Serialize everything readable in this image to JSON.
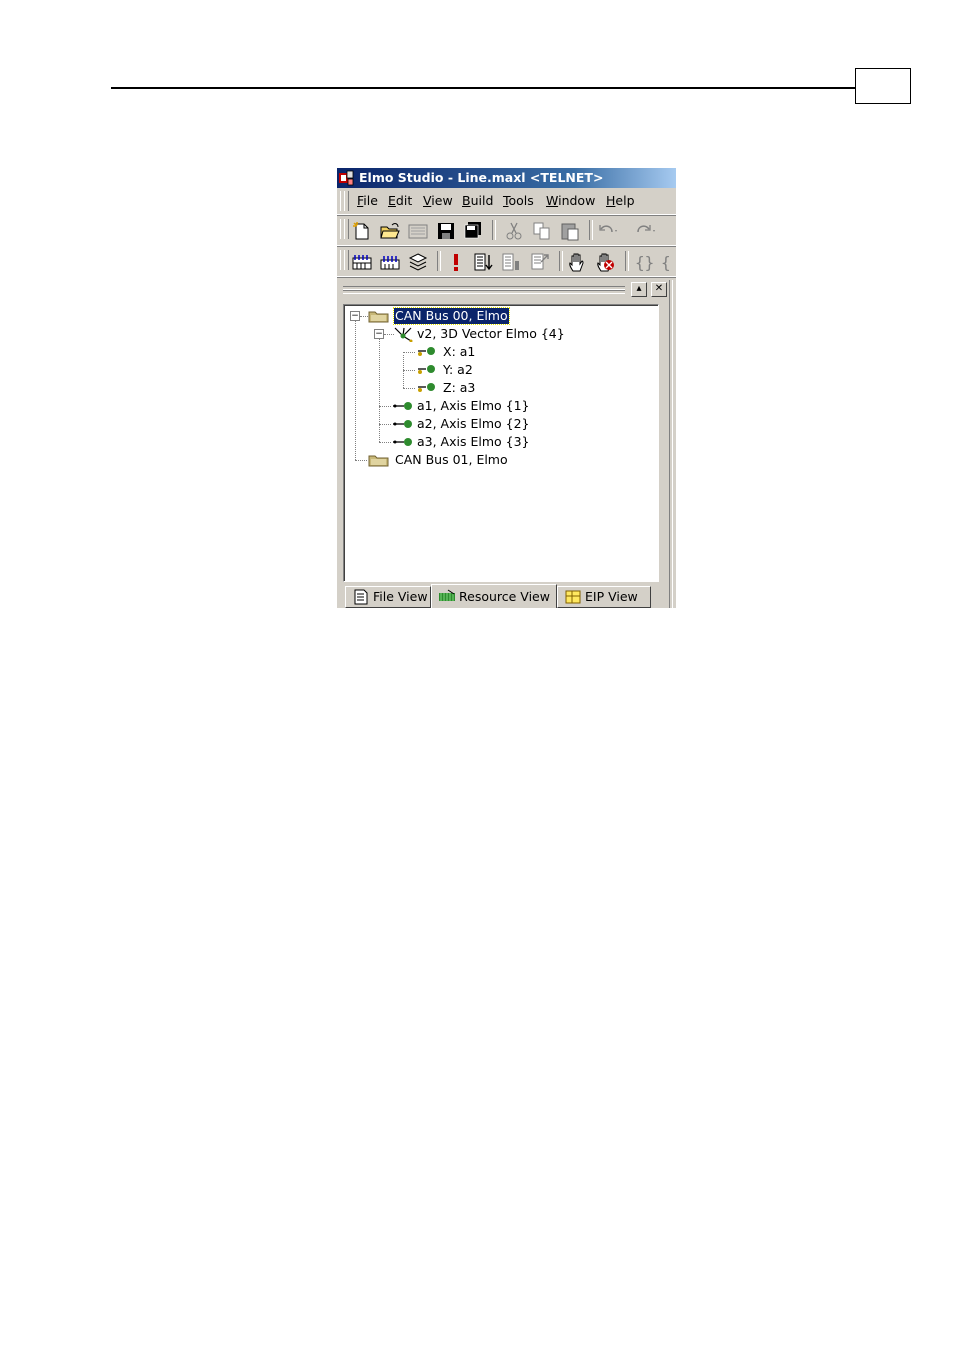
{
  "window": {
    "title": "Elmo Studio - Line.maxl <TELNET>"
  },
  "menu": [
    {
      "key": "F",
      "rest": "ile"
    },
    {
      "key": "E",
      "rest": "dit"
    },
    {
      "key": "V",
      "rest": "iew"
    },
    {
      "key": "B",
      "rest": "uild"
    },
    {
      "key": "T",
      "rest": "ools"
    },
    {
      "key": "W",
      "rest": "indow"
    },
    {
      "key": "H",
      "rest": "elp"
    }
  ],
  "toolbar1": [
    "new-file-icon",
    "open-folder-icon",
    "workspace-icon",
    "save-icon",
    "save-all-icon",
    "cut-icon",
    "copy-icon",
    "paste-icon",
    "undo-icon",
    "redo-icon"
  ],
  "toolbar2": [
    "build-icon",
    "rebuild-icon",
    "layers-icon",
    "exclamation-icon",
    "download-icon",
    "upload-icon",
    "compare-icon",
    "stop-hand-icon",
    "stop-all-icon",
    "brace-icon"
  ],
  "tree": {
    "bus0": "CAN Bus 00, Elmo",
    "v2": "v2, 3D Vector Elmo {4}",
    "x": "X: a1",
    "y": "Y: a2",
    "z": "Z: a3",
    "a1": "a1, Axis Elmo {1}",
    "a2": "a2, Axis Elmo {2}",
    "a3": "a3, Axis Elmo {3}",
    "bus1": "CAN Bus 01, Elmo"
  },
  "tabs": {
    "file": "File View",
    "resource": "Resource View",
    "eip": "EIP View",
    "active": "resource"
  },
  "colors": {
    "titlebar": "#0a246a",
    "face": "#d4d0c8",
    "selection": "#0a246a",
    "folder": "#c8b878",
    "axis_green": "#2e8b2e"
  }
}
